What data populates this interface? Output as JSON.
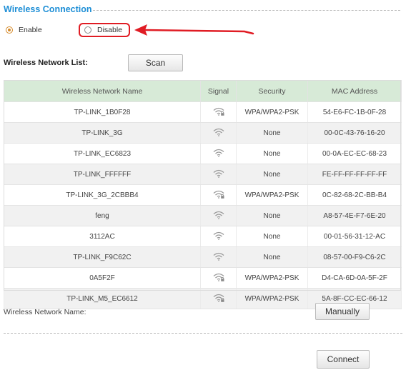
{
  "section_title": "Wireless Connection",
  "connection": {
    "enable_label": "Enable",
    "disable_label": "Disable",
    "selected": "Enable"
  },
  "list_label": "Wireless Network List:",
  "scan_button": "Scan",
  "table": {
    "headers": [
      "Wireless Network Name",
      "Signal",
      "Security",
      "MAC Address"
    ],
    "rows": [
      {
        "name": "TP-LINK_1B0F28",
        "signal_icon": "wifi-lock-icon",
        "security": "WPA/WPA2-PSK",
        "mac": "54-E6-FC-1B-0F-28"
      },
      {
        "name": "TP-LINK_3G",
        "signal_icon": "wifi-icon",
        "security": "None",
        "mac": "00-0C-43-76-16-20"
      },
      {
        "name": "TP-LINK_EC6823",
        "signal_icon": "wifi-icon",
        "security": "None",
        "mac": "00-0A-EC-EC-68-23"
      },
      {
        "name": "TP-LINK_FFFFFF",
        "signal_icon": "wifi-icon",
        "security": "None",
        "mac": "FE-FF-FF-FF-FF-FF"
      },
      {
        "name": "TP-LINK_3G_2CBBB4",
        "signal_icon": "wifi-lock-icon",
        "security": "WPA/WPA2-PSK",
        "mac": "0C-82-68-2C-BB-B4"
      },
      {
        "name": "feng",
        "signal_icon": "wifi-icon",
        "security": "None",
        "mac": "A8-57-4E-F7-6E-20"
      },
      {
        "name": "3112AC",
        "signal_icon": "wifi-icon",
        "security": "None",
        "mac": "00-01-56-31-12-AC"
      },
      {
        "name": "TP-LINK_F9C62C",
        "signal_icon": "wifi-icon",
        "security": "None",
        "mac": "08-57-00-F9-C6-2C"
      },
      {
        "name": "0A5F2F",
        "signal_icon": "wifi-lock-icon",
        "security": "WPA/WPA2-PSK",
        "mac": "D4-CA-6D-0A-5F-2F"
      },
      {
        "name": "TP-LINK_M5_EC6612",
        "signal_icon": "wifi-lock-icon",
        "security": "WPA/WPA2-PSK",
        "mac": "5A-8F-CC-EC-66-12"
      }
    ]
  },
  "network_name_label": "Wireless Network Name:",
  "manually_button": "Manually",
  "connect_button": "Connect",
  "colors": {
    "title": "#1f8fd6",
    "header_bg": "#d7ead7",
    "annotation": "#e01c24",
    "radio_selected": "#d58a2a"
  }
}
